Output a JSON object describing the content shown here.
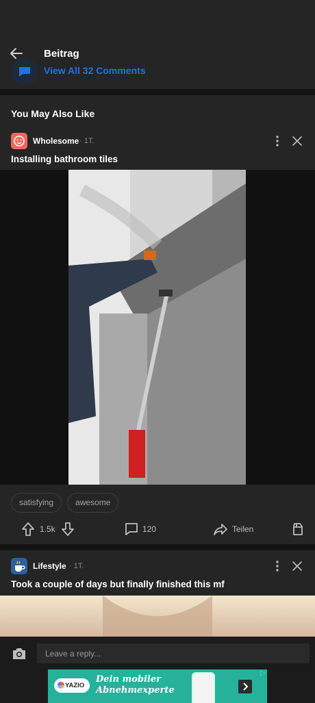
{
  "header": {
    "title": "Beitrag",
    "view_comments": "View All 32 Comments"
  },
  "section": {
    "title": "You May Also Like"
  },
  "posts": [
    {
      "category": "Wholesome",
      "time": "1T.",
      "title": "Installing bathroom tiles",
      "tags": [
        "satisfying",
        "awesome"
      ],
      "upvotes": "1.5k",
      "comments": "120",
      "share_label": "Teilen",
      "avatar_color": "#f2675c"
    },
    {
      "category": "Lifestyle",
      "time": "1T.",
      "title": "Took a couple of days but finally finished this mf",
      "avatar_color": "#2b5f9e"
    }
  ],
  "reply": {
    "placeholder": "Leave a reply..."
  },
  "ad": {
    "brand": "YAZIO",
    "headline_line1": "Dein mobiler",
    "headline_line2": "Abnehmexperte"
  },
  "colors": {
    "accent": "#1e73e8",
    "background": "#1c1c1c",
    "card": "#252525",
    "ad_bg": "#26b29a"
  }
}
